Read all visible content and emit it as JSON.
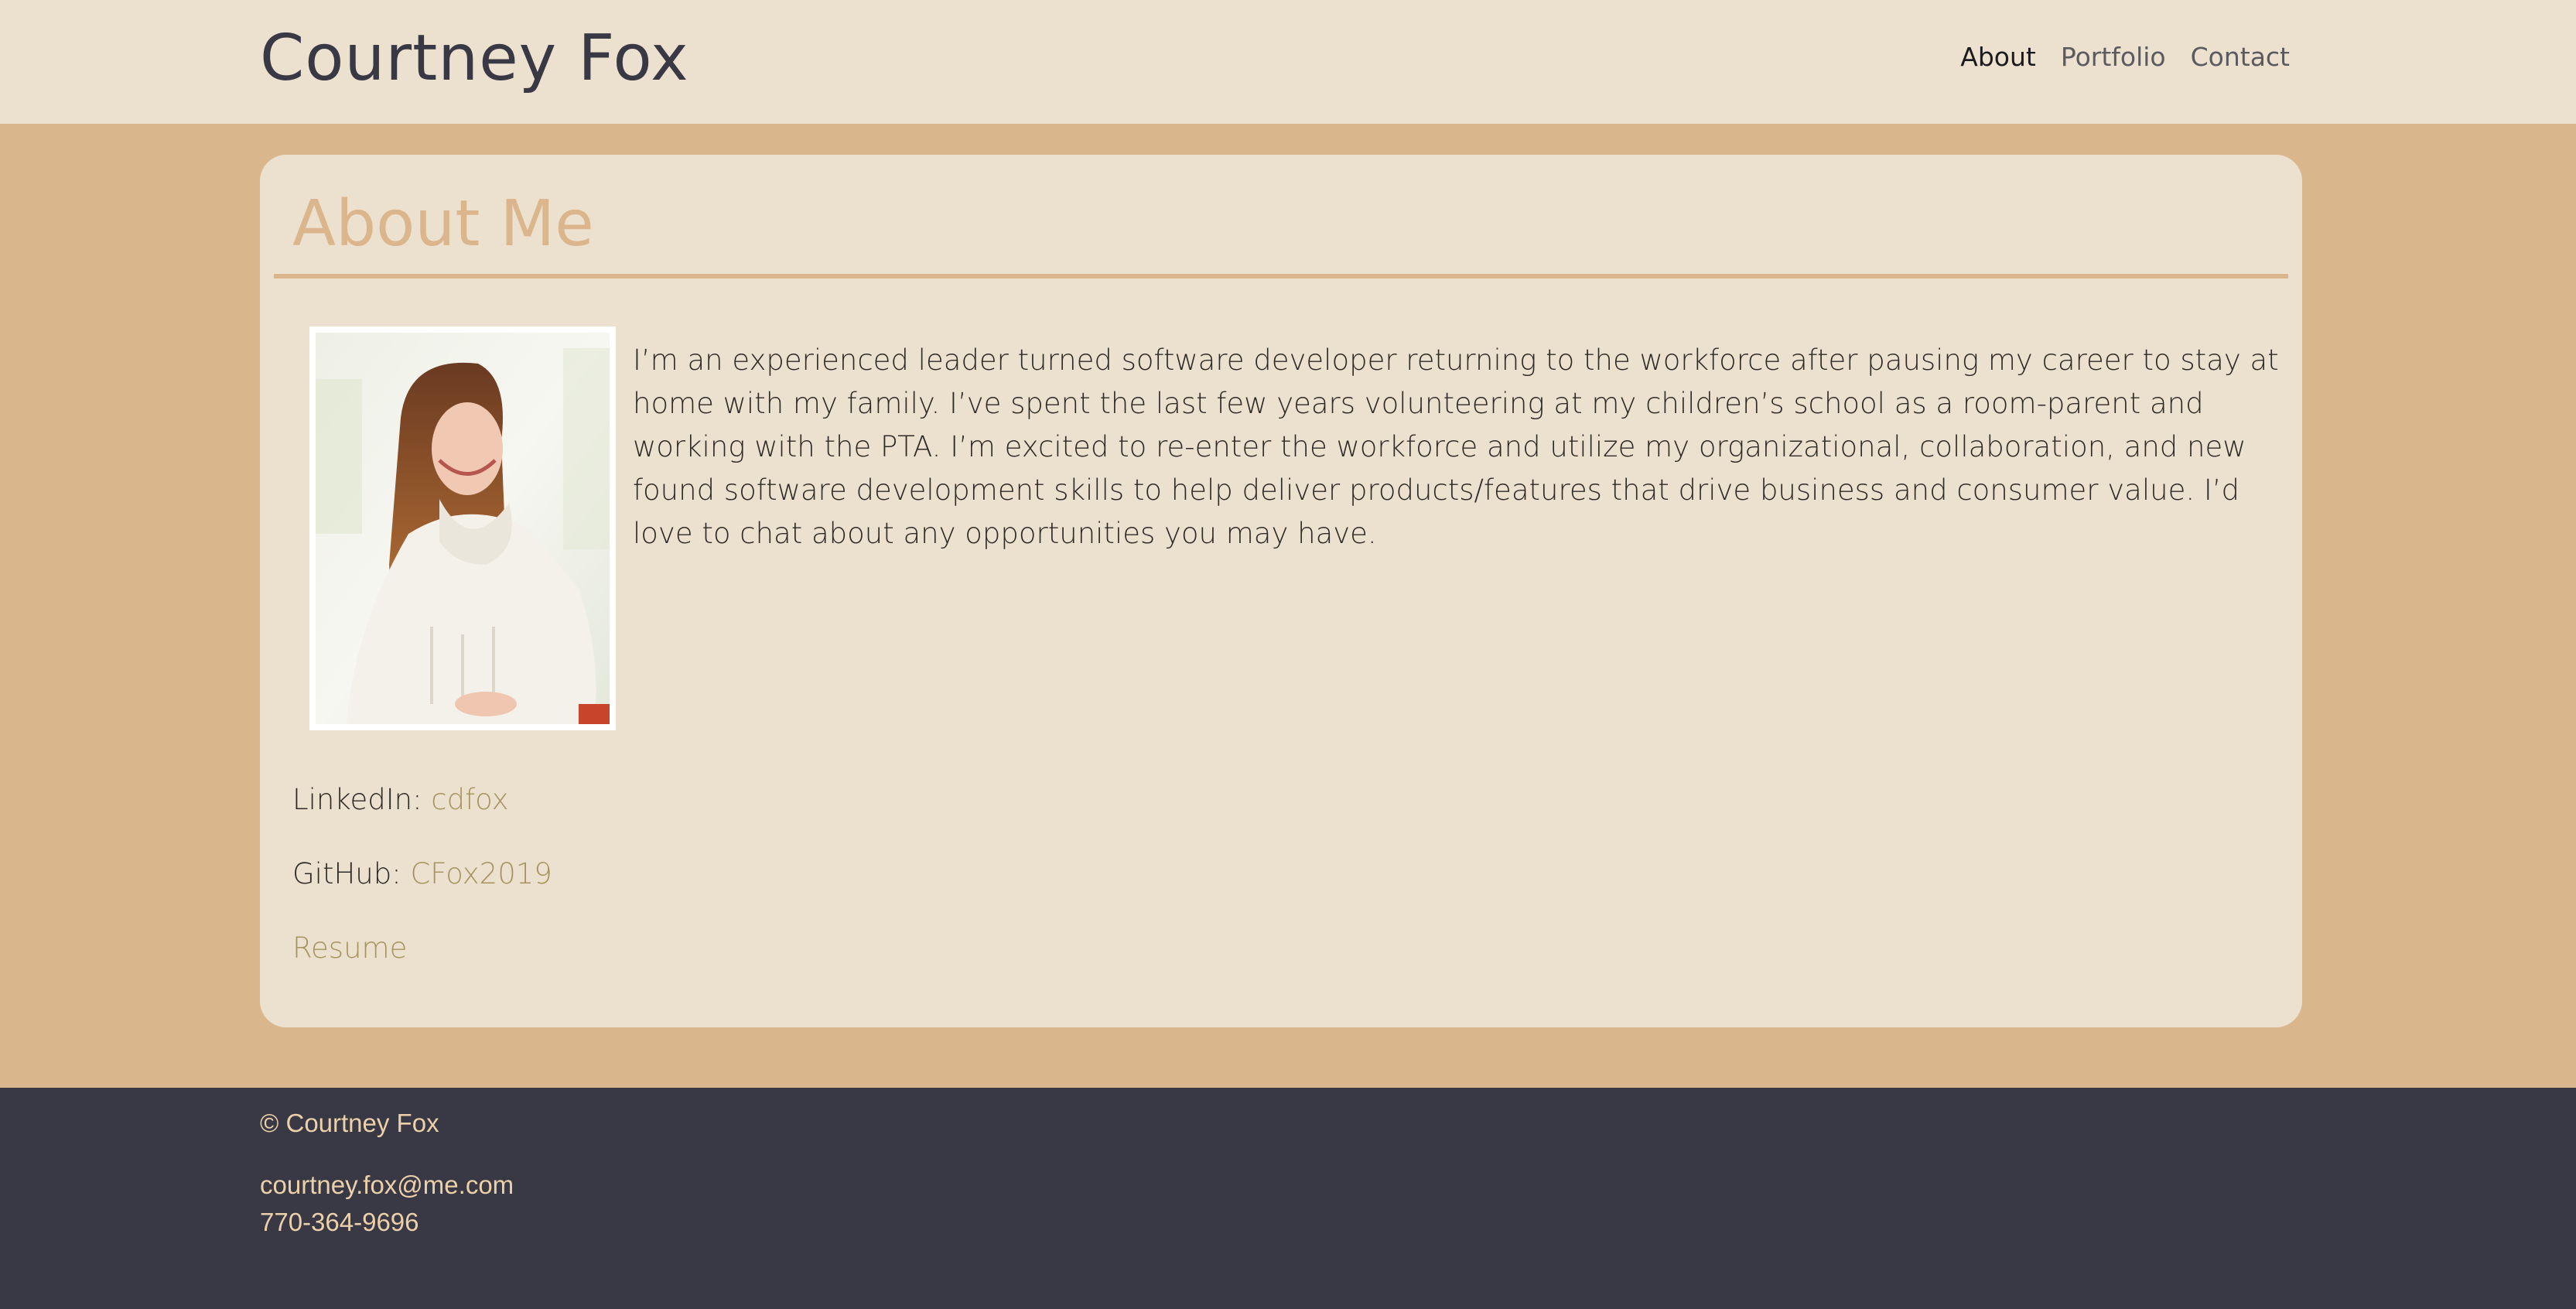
{
  "header": {
    "site_title": "Courtney Fox",
    "nav": [
      {
        "label": "About",
        "active": true
      },
      {
        "label": "Portfolio",
        "active": false
      },
      {
        "label": "Contact",
        "active": false
      }
    ]
  },
  "about": {
    "title": "About Me",
    "bio": "I’m an experienced leader turned software developer returning to the workforce after pausing my career to stay at home with my family. I’ve spent the last few years volunteering at my children’s school as a room-parent and working with the PTA. I’m excited to re-enter the workforce and utilize my organizational, collaboration, and new found software development skills to help deliver products/features that drive business and consumer value. I’d love to chat about any opportunities you may have.",
    "linkedin_label": "LinkedIn: ",
    "linkedin_value": "cdfox",
    "github_label": "GitHub: ",
    "github_value": "CFox2019",
    "resume_label": "Resume"
  },
  "footer": {
    "copyright": "© Courtney Fox",
    "email": "courtney.fox@me.com",
    "phone": "770-364-9696"
  },
  "colors": {
    "page_background": "#dab68d",
    "panel_background": "#ece1cf",
    "accent": "#dbb68d",
    "link": "#a6945f",
    "footer_background": "#383945",
    "footer_text": "#ecd0aa"
  }
}
